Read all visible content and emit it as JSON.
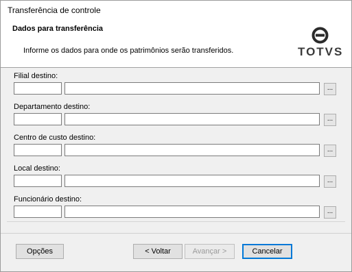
{
  "window": {
    "title": "Transferência de controle"
  },
  "header": {
    "heading": "Dados para transferência",
    "subtitle": "Informe os dados para onde os patrimônios serão transferidos.",
    "logo_text": "TOTVS"
  },
  "fields": [
    {
      "label": "Filial destino:",
      "code": "",
      "description": "",
      "lookup": "..."
    },
    {
      "label": "Departamento destino:",
      "code": "",
      "description": "",
      "lookup": "..."
    },
    {
      "label": "Centro de custo destino:",
      "code": "",
      "description": "",
      "lookup": "..."
    },
    {
      "label": "Local destino:",
      "code": "",
      "description": "",
      "lookup": "..."
    },
    {
      "label": "Funcionário destino:",
      "code": "",
      "description": "",
      "lookup": "..."
    }
  ],
  "footer": {
    "options_label": "Opções",
    "back_label": "< Voltar",
    "next_label": "Avançar >",
    "cancel_label": "Cancelar"
  }
}
